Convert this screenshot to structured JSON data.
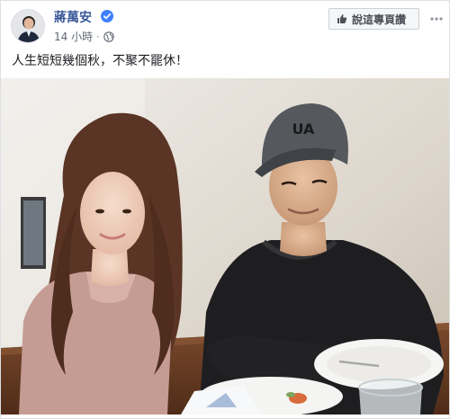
{
  "post": {
    "author": "蔣萬安",
    "timestamp": "14 小時",
    "privacy_icon": "globe-icon",
    "verified_icon": "verified-badge-icon",
    "text": "人生短短幾個秋，不聚不罷休！"
  },
  "actions": {
    "like_page_label": "說這專頁讚",
    "like_icon": "thumbs-up-icon",
    "more_icon": "more-options-icon"
  },
  "colors": {
    "author_link": "#385898",
    "verified_blue": "#4080ff",
    "meta_gray": "#616770",
    "button_bg": "#f5f6f7"
  }
}
